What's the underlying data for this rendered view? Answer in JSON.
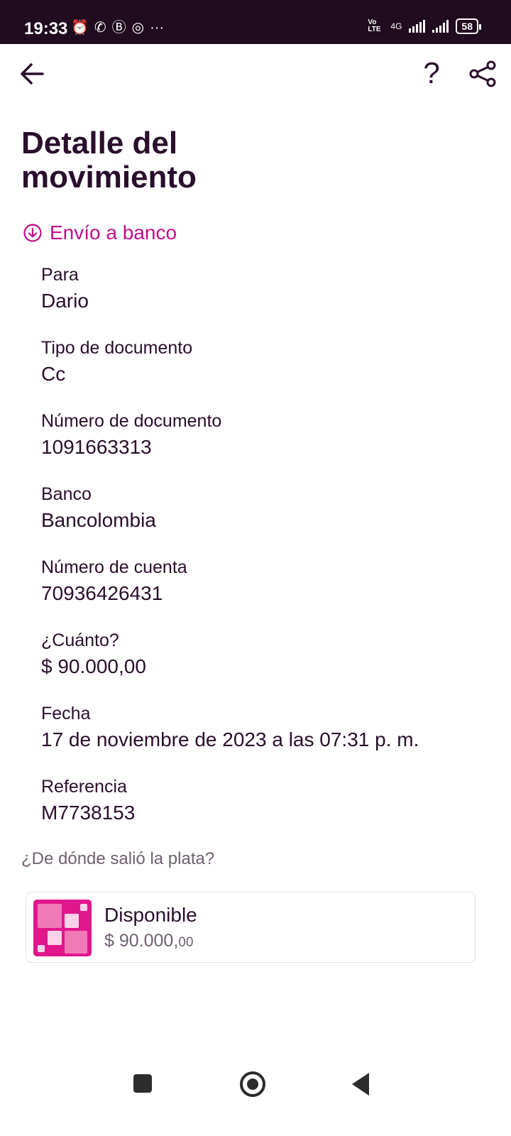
{
  "status_bar": {
    "time": "19:33",
    "network": "4G",
    "volte": "Vo LTE",
    "battery": "58",
    "more": "···"
  },
  "header": {
    "help_label": "?",
    "title": "Detalle del movimiento"
  },
  "transaction": {
    "type_label": "Envío a banco",
    "accent_color": "#c10e8b"
  },
  "fields": [
    {
      "label": "Para",
      "value": "Dario"
    },
    {
      "label": "Tipo de documento",
      "value": "Cc"
    },
    {
      "label": "Número de documento",
      "value": "1091663313"
    },
    {
      "label": "Banco",
      "value": "Bancolombia"
    },
    {
      "label": "Número de cuenta",
      "value": "70936426431"
    },
    {
      "label": "¿Cuánto?",
      "value": "$ 90.000,00"
    },
    {
      "label": "Fecha",
      "value": "17 de noviembre de 2023 a las 07:31 p. m."
    },
    {
      "label": "Referencia",
      "value": "M7738153"
    }
  ],
  "source": {
    "heading": "¿De dónde salió la plata?",
    "account_name": "Disponible",
    "balance_main": "$ 90.000,",
    "balance_cents": "00",
    "logo_color": "#e1168d"
  }
}
